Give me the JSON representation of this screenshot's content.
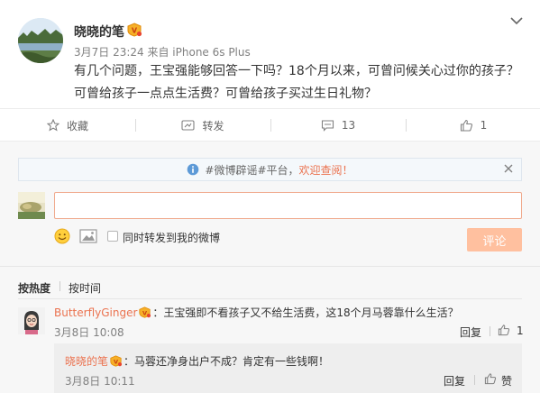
{
  "post": {
    "author": "晓晓的笔",
    "meta": "3月7日 23:24 来自 iPhone 6s Plus",
    "text_line1": "有几个问题，王宝强能够回答一下吗？18个月以来，可曾问候关心过你的孩子？",
    "text_line2": "可曾给孩子一点点生活费？可曾给孩子买过生日礼物？"
  },
  "actions": {
    "favorite": "收藏",
    "repost": "转发",
    "comment_count": "13",
    "like_count": "1"
  },
  "notice": {
    "prefix": "#微博辟谣#平台，",
    "link": "欢迎查阅！"
  },
  "composer": {
    "repost_label": "同时转发到我的微博",
    "submit": "评论"
  },
  "sort": {
    "hot": "按热度",
    "time": "按时间"
  },
  "comment": {
    "user": "ButterflyGinger",
    "text": "：王宝强即不看孩子又不给生活费，这18个月马蓉靠什么生活？",
    "time": "3月8日 10:08",
    "reply": "回复",
    "likes": "1"
  },
  "sub_comment": {
    "user": "晓晓的笔",
    "text": "：马蓉还净身出户不成？肯定有一些钱啊！",
    "time": "3月8日 10:11",
    "reply": "回复",
    "like_label": "赞"
  },
  "colors": {
    "accent": "#eb7350",
    "button_disabled": "#ffc09f"
  }
}
